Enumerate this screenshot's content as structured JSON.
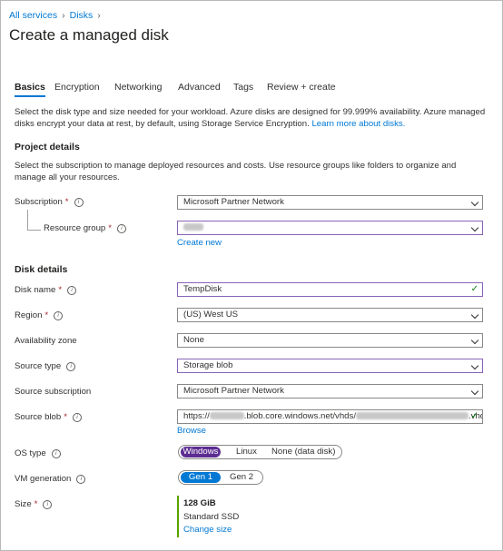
{
  "breadcrumb": [
    "All services",
    "Disks"
  ],
  "page_title": "Create a managed disk",
  "tabs": [
    "Basics",
    "Encryption",
    "Networking",
    "Advanced",
    "Tags",
    "Review + create"
  ],
  "active_tab": "Basics",
  "intro": {
    "line1": "Select the disk type and size needed for your workload. Azure disks are designed for 99.999% availability. Azure managed",
    "line2": "disks encrypt your data at rest, by default, using Storage Service Encryption.",
    "link": "Learn more about disks."
  },
  "project_details": {
    "heading": "Project details",
    "desc_line1": "Select the subscription to manage deployed resources and costs. Use resource groups like folders to organize and",
    "desc_line2": "manage all your resources.",
    "subscription_label": "Subscription",
    "subscription_value": "Microsoft Partner Network",
    "resource_group_label": "Resource group",
    "create_new": "Create new"
  },
  "disk_details": {
    "heading": "Disk details",
    "disk_name_label": "Disk name",
    "disk_name_value": "TempDisk",
    "region_label": "Region",
    "region_value": "(US) West US",
    "availability_zone_label": "Availability zone",
    "availability_zone_value": "None",
    "source_type_label": "Source type",
    "source_type_value": "Storage blob",
    "source_subscription_label": "Source subscription",
    "source_subscription_value": "Microsoft Partner Network",
    "source_blob_label": "Source blob",
    "source_blob_prefix": "https://",
    "source_blob_middle": ".blob.core.windows.net/vhds/",
    "source_blob_suffix": ".vhd",
    "browse": "Browse",
    "os_type_label": "OS type",
    "os_type_options": [
      "Windows",
      "Linux",
      "None (data disk)"
    ],
    "os_type_selected": "Windows",
    "vm_generation_label": "VM generation",
    "vm_generation_options": [
      "Gen 1",
      "Gen 2"
    ],
    "vm_generation_selected": "Gen 1",
    "size_label": "Size",
    "size_value": "128 GiB",
    "size_tier": "Standard SSD",
    "change_size": "Change size"
  },
  "colors": {
    "accent": "#0078d4",
    "purple_selected": "#5c2d91",
    "success": "#107c10",
    "required": "#a4262c"
  },
  "icons": {
    "info": "info-icon",
    "dropdown": "chevron-down-icon",
    "valid": "checkmark-icon"
  }
}
